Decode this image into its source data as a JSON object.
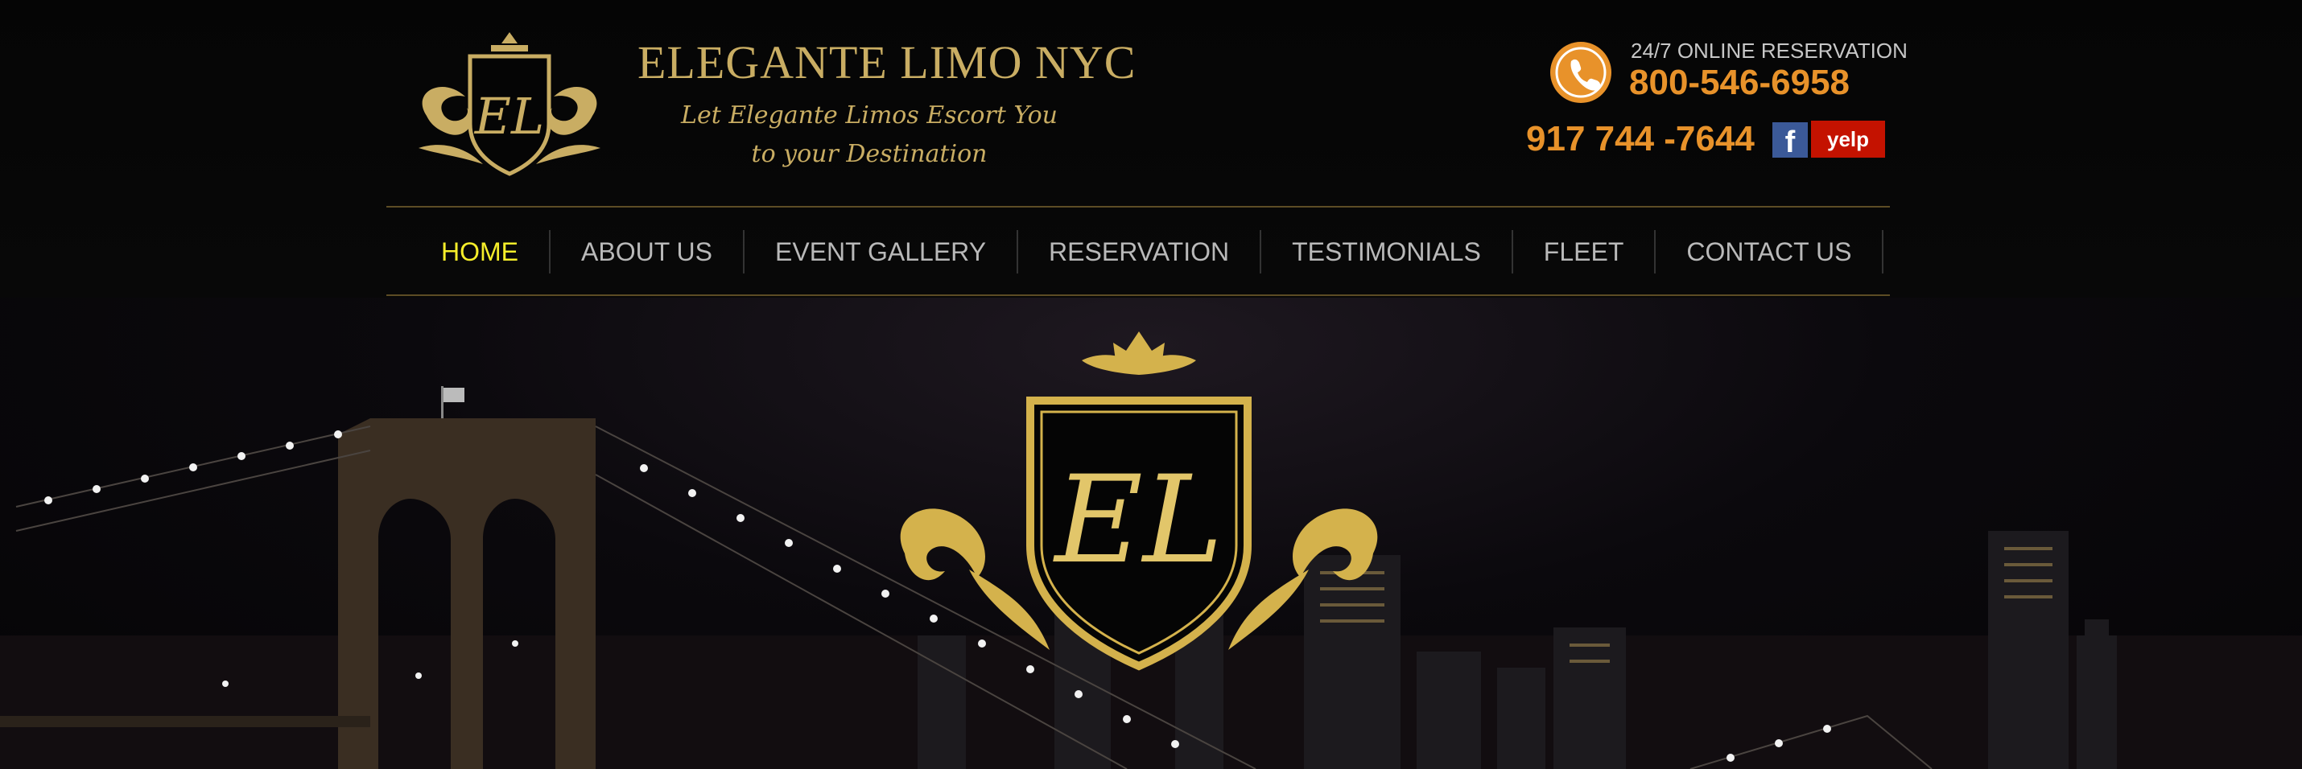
{
  "brand": {
    "title": "ELEGANTE LIMO NYC",
    "tagline_line1": "Let Elegante Limos Escort You",
    "tagline_line2": "to your Destination",
    "monogram": "EL",
    "gold_color": "#c9ad63"
  },
  "contact": {
    "reservation_label": "24/7 ONLINE RESERVATION",
    "reservation_phone": "800-546-6958",
    "main_phone": "917 744 -7644",
    "phone_icon": "phone-icon",
    "accent_color": "#e8922a"
  },
  "social": {
    "facebook_label": "f",
    "yelp_label": "yelp"
  },
  "nav": {
    "active_color": "#f6ee2a",
    "items": [
      {
        "label": "HOME"
      },
      {
        "label": "ABOUT US"
      },
      {
        "label": "EVENT GALLERY"
      },
      {
        "label": "RESERVATION"
      },
      {
        "label": "TESTIMONIALS"
      },
      {
        "label": "FLEET"
      },
      {
        "label": "CONTACT US"
      }
    ]
  }
}
